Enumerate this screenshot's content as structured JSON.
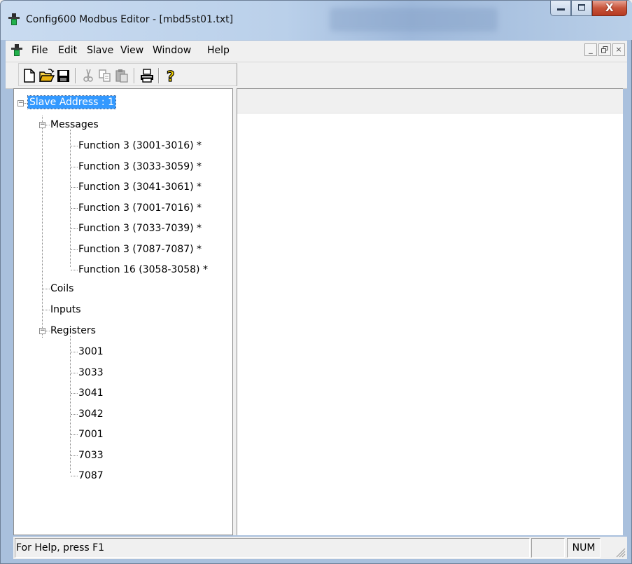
{
  "window": {
    "title": "Config600 Modbus Editor - [mbd5st01.txt]",
    "caption_buttons": [
      "minimize-icon",
      "maximize-icon",
      "close-icon"
    ]
  },
  "menu": {
    "items": [
      "File",
      "Edit",
      "Slave",
      "View",
      "Window",
      "Help"
    ],
    "mdi_buttons": [
      "_",
      "ə",
      "×"
    ]
  },
  "toolbar": {
    "buttons": [
      "new-icon",
      "open-icon",
      "save-icon",
      "cut-icon",
      "copy-icon",
      "paste-icon",
      "print-icon",
      "help-icon"
    ]
  },
  "tree": {
    "root": "Slave Address : 1",
    "messages_label": "Messages",
    "messages": [
      "Function 3 (3001-3016) *",
      "Function 3 (3033-3059) *",
      "Function 3 (3041-3061) *",
      "Function 3 (7001-7016) *",
      "Function 3 (7033-7039) *",
      "Function 3 (7087-7087) *",
      "Function 16 (3058-3058) *"
    ],
    "coils_label": "Coils",
    "inputs_label": "Inputs",
    "registers_label": "Registers",
    "registers": [
      "3001",
      "3033",
      "3041",
      "3042",
      "7001",
      "7033",
      "7087"
    ]
  },
  "status": {
    "help_text": "For Help, press F1",
    "cap_indicator": "",
    "num_indicator": "NUM"
  },
  "colors": {
    "selection": "#3399ff",
    "title_gradient": "#bad0ea",
    "close_button": "#c8543a"
  }
}
